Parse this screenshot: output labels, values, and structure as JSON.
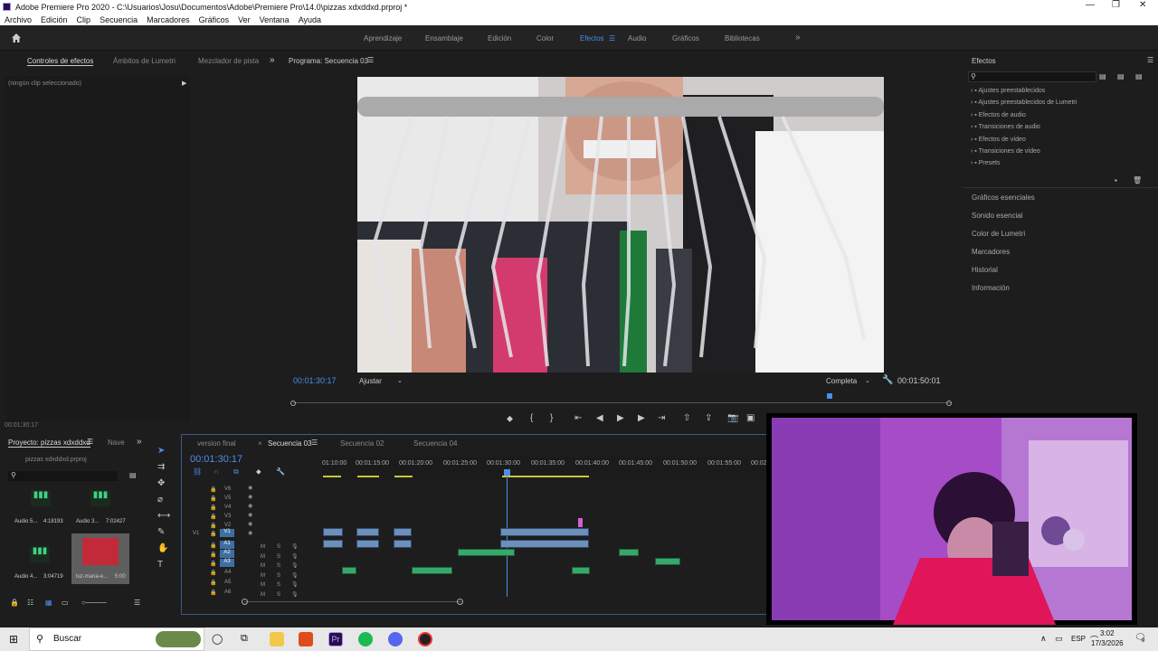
{
  "window": {
    "title": "Adobe Premiere Pro 2020 - C:\\Usuarios\\Josu\\Documentos\\Adobe\\Premiere Pro\\14.0\\pizzas xdxddxd.prproj *"
  },
  "menu": [
    "Archivo",
    "Edición",
    "Clip",
    "Secuencia",
    "Marcadores",
    "Gráficos",
    "Ver",
    "Ventana",
    "Ayuda"
  ],
  "workspaces": [
    "Aprendizaje",
    "Ensamblaje",
    "Edición",
    "Color",
    "Efectos",
    "Audio",
    "Gráficos",
    "Bibliotecas"
  ],
  "active_workspace": "Efectos",
  "left_tabs": {
    "effect_controls": "Controles de efectos",
    "lumetri_scopes": "Ámbitos de Lumetri",
    "audio_mixer": "Mezclador de pista"
  },
  "no_clip": "(ningún clip seleccionado)",
  "effect_time": "00:01:30:17",
  "program": {
    "title": "Programa: Secuencia 03",
    "timecode": "00:01:30:17",
    "fit": "Ajustar",
    "quality": "Completa",
    "duration": "00:01:50:01"
  },
  "effects_panel": {
    "title": "Efectos",
    "folders": [
      "Ajustes preestablecidos",
      "Ajustes preestablecidos de Lumetri",
      "Efectos de audio",
      "Transiciones de audio",
      "Efectos de vídeo",
      "Transiciones de vídeo",
      "Presets"
    ],
    "sections": [
      "Gráficos esenciales",
      "Sonido esencial",
      "Color de Lumetri",
      "Marcadores",
      "Historial",
      "Información"
    ]
  },
  "project": {
    "tab": "Proyecto: pizzas xdxddxd",
    "nav": "Nave",
    "file": "pizzas xdxddxd.prproj",
    "items": [
      {
        "name": "Audio 5...",
        "dur": "4:18193"
      },
      {
        "name": "Audio 3...",
        "dur": "7:02427"
      },
      {
        "name": "Audio 4...",
        "dur": "3:04719"
      },
      {
        "name": "luz-maria-e...",
        "dur": "5:00"
      }
    ]
  },
  "timeline": {
    "tabs": [
      "version final",
      "Secuencia 03",
      "Secuencia 02",
      "Secuencia 04"
    ],
    "active": "Secuencia 03",
    "timecode": "00:01:30:17",
    "ruler": [
      "01:10:00",
      "00:01:15:00",
      "00:01:20:00",
      "00:01:25:00",
      "00:01:30:00",
      "00:01:35:00",
      "00:01:40:00",
      "00:01:45:00",
      "00:01:50:00",
      "00:01:55:00",
      "00:02"
    ],
    "video_tracks": [
      "V6",
      "V5",
      "V4",
      "V3",
      "V2",
      "V1"
    ],
    "audio_tracks": [
      "A1",
      "A2",
      "A3",
      "A4",
      "A5",
      "A6"
    ]
  },
  "taskbar": {
    "search": "Buscar",
    "lang": "ESP",
    "time": "3:02",
    "date": "17/3/2026",
    "notif": "9"
  },
  "colors": {
    "accent": "#4a8fe6",
    "video_clip": "#6d8fb8",
    "audio_clip": "#37a86a"
  }
}
